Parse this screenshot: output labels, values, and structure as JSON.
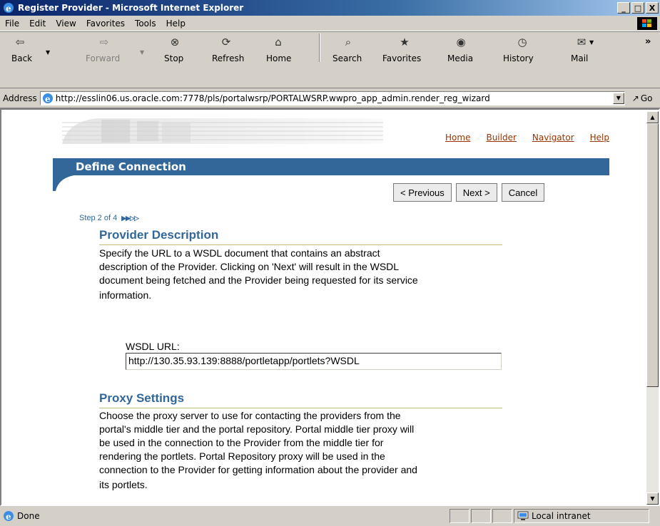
{
  "window": {
    "title": "Register Provider - Microsoft Internet Explorer",
    "minimize": "_",
    "maximize": "□",
    "close": "X"
  },
  "menu": [
    "File",
    "Edit",
    "View",
    "Favorites",
    "Tools",
    "Help"
  ],
  "toolbar": {
    "back": "Back",
    "forward": "Forward",
    "stop": "Stop",
    "refresh": "Refresh",
    "home": "Home",
    "search": "Search",
    "favorites": "Favorites",
    "media": "Media",
    "history": "History",
    "mail": "Mail",
    "more": "»"
  },
  "address": {
    "label": "Address",
    "url": "http://esslin06.us.oracle.com:7778/pls/portalwsrp/PORTALWSRP.wwpro_app_admin.render_reg_wizard",
    "go": "Go"
  },
  "page": {
    "links": [
      "Home",
      "Builder",
      "Navigator",
      "Help"
    ],
    "header_title": "Define Connection",
    "buttons": {
      "previous": "< Previous",
      "next": "Next >",
      "cancel": "Cancel"
    },
    "step": "Step 2 of 4",
    "step_indicator": "▶▶▷▷",
    "provider_description": {
      "title": "Provider Description",
      "lines": [
        "Specify the URL to a WSDL document that contains an abstract",
        "description of the Provider. Clicking on 'Next' will result in the WSDL",
        "document being fetched and the Provider being requested for its service",
        "information."
      ]
    },
    "wsdl": {
      "label": "WSDL URL:",
      "value": "http://130.35.93.139:8888/portletapp/portlets?WSDL"
    },
    "proxy_settings": {
      "title": "Proxy Settings",
      "lines": [
        "Choose the proxy server to use for contacting the providers from the",
        "portal's middle tier and the portal repository. Portal middle tier proxy will",
        "be used in the connection to the Provider from the middle tier for",
        "rendering the portlets. Portal Repository proxy will be used in the",
        "connection to the Provider for getting information about the provider and",
        "its portlets."
      ]
    }
  },
  "status": {
    "text": "Done",
    "zone": "Local intranet"
  }
}
